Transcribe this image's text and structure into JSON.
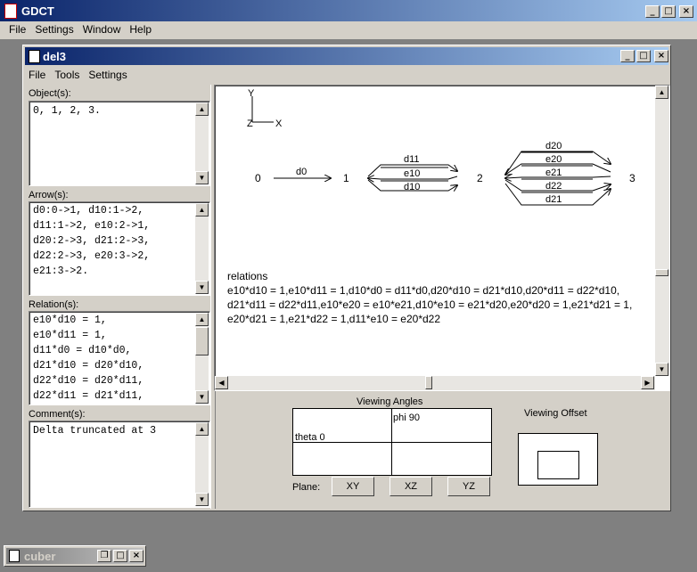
{
  "app": {
    "title": "GDCT",
    "menu": [
      "File",
      "Settings",
      "Window",
      "Help"
    ]
  },
  "inner": {
    "title": "del3",
    "menu": [
      "File",
      "Tools",
      "Settings"
    ]
  },
  "panels": {
    "objects": {
      "label": "Object(s):",
      "text": "0, 1, 2, 3."
    },
    "arrows": {
      "label": "Arrow(s):",
      "text": "d0:0->1, d10:1->2,\nd11:1->2, e10:2->1,\nd20:2->3, d21:2->3,\nd22:2->3, e20:3->2,\ne21:3->2."
    },
    "relations": {
      "label": "Relation(s):",
      "text": "e10*d10 = 1,\ne10*d11 = 1,\nd11*d0 = d10*d0,\nd21*d10 = d20*d10,\nd22*d10 = d20*d11,\nd22*d11 = d21*d11,"
    },
    "comments": {
      "label": "Comment(s):",
      "text": "Delta truncated at 3"
    }
  },
  "diagram": {
    "axes": {
      "y": "Y",
      "z": "Z",
      "x": "X"
    },
    "nodes": [
      "0",
      "1",
      "2",
      "3"
    ],
    "arrows": {
      "d0": "d0",
      "d11": "d11",
      "e10": "e10",
      "d10": "d10",
      "d20": "d20",
      "e20": "e20",
      "e21": "e21",
      "d22": "d22",
      "d21": "d21"
    },
    "relations_title": "relations",
    "relations_lines": [
      "e10*d10 = 1,e10*d11 = 1,d10*d0 = d11*d0,d20*d10 = d21*d10,d20*d11 = d22*d10,",
      "d21*d11 = d22*d11,e10*e20 = e10*e21,d10*e10 = e21*d20,e20*d20 = 1,e21*d21 = 1,",
      "e20*d21 = 1,e21*d22 = 1,d11*e10 = e20*d22"
    ]
  },
  "controls": {
    "viewing_angles": "Viewing Angles",
    "phi": "phi 90",
    "theta": "theta 0",
    "viewing_offset": "Viewing Offset",
    "plane_label": "Plane:",
    "plane_buttons": [
      "XY",
      "XZ",
      "YZ"
    ]
  },
  "minimized": {
    "title": "cuber"
  }
}
